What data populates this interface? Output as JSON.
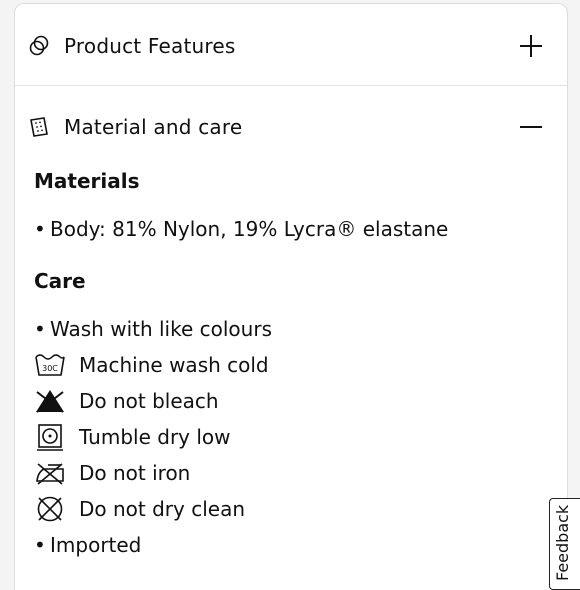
{
  "accordion": {
    "product_features": {
      "title": "Product Features",
      "icon": "product-features-icon",
      "toggle_icon": "plus-icon"
    },
    "material_care": {
      "title": "Material and care",
      "icon": "fabric-swatch-icon",
      "toggle_icon": "minus-icon",
      "materials_heading": "Materials",
      "materials": [
        "Body: 81% Nylon, 19% Lycra® elastane"
      ],
      "care_heading": "Care",
      "care_intro": "Wash with like colours",
      "care_items": [
        {
          "icon": "machine-wash-30c-icon",
          "label": "Machine wash cold",
          "icon_text": "30C"
        },
        {
          "icon": "do-not-bleach-icon",
          "label": "Do not bleach"
        },
        {
          "icon": "tumble-dry-low-icon",
          "label": "Tumble dry low"
        },
        {
          "icon": "do-not-iron-icon",
          "label": "Do not iron"
        },
        {
          "icon": "do-not-dry-clean-icon",
          "label": "Do not dry clean"
        }
      ],
      "origin": "Imported"
    }
  },
  "feedback": {
    "label": "Feedback"
  }
}
